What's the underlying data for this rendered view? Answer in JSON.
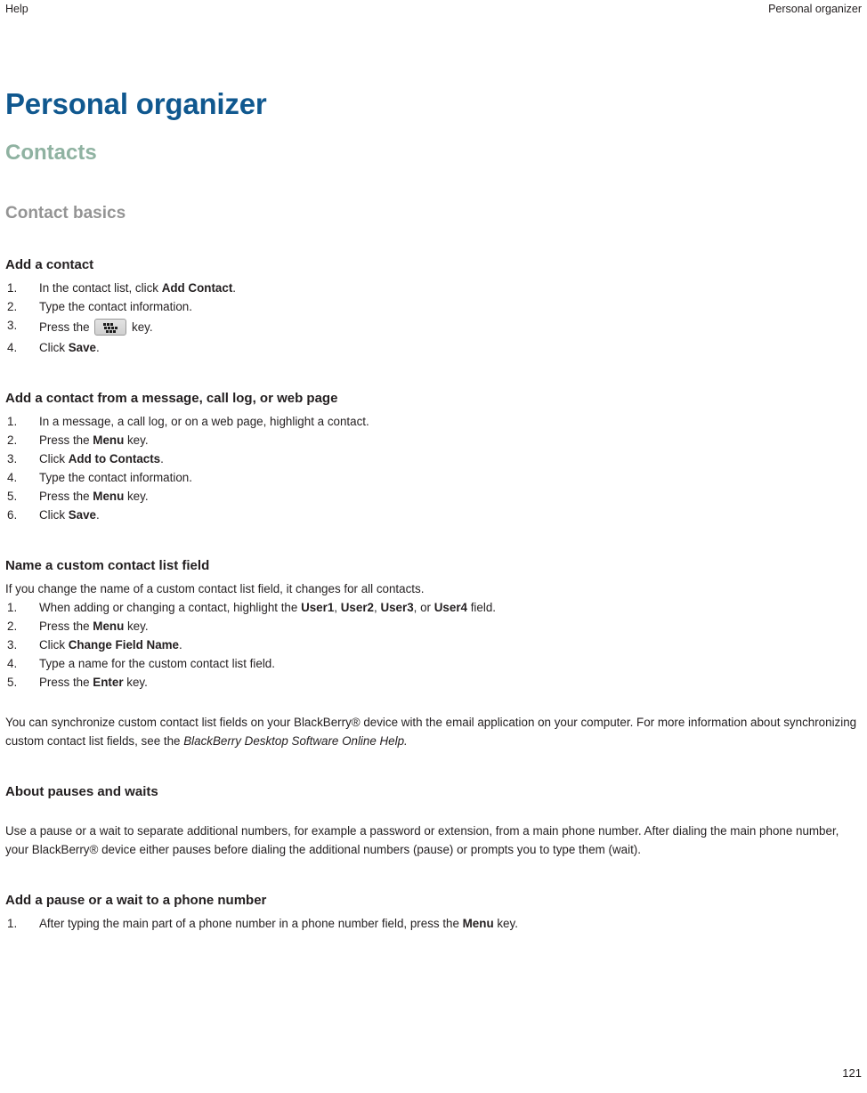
{
  "header": {
    "left": "Help",
    "right": "Personal organizer"
  },
  "footer": {
    "page_number": "121"
  },
  "colors": {
    "title_blue": "#10588f",
    "chapter_green": "#8fb2a1",
    "section_gray": "#949494",
    "body_text": "#231f20"
  },
  "doc": {
    "title": "Personal organizer",
    "chapter": "Contacts",
    "section": "Contact basics"
  },
  "tasks": [
    {
      "heading": "Add a contact",
      "steps": [
        {
          "num": "1.",
          "parts": [
            {
              "t": "text",
              "v": "In the contact list, click "
            },
            {
              "t": "bold",
              "v": "Add Contact"
            },
            {
              "t": "text",
              "v": "."
            }
          ]
        },
        {
          "num": "2.",
          "parts": [
            {
              "t": "text",
              "v": "Type the contact information."
            }
          ]
        },
        {
          "num": "3.",
          "parts": [
            {
              "t": "text",
              "v": "Press the "
            },
            {
              "t": "key",
              "v": "blackberry-menu-key"
            },
            {
              "t": "text",
              "v": " key."
            }
          ]
        },
        {
          "num": "4.",
          "parts": [
            {
              "t": "text",
              "v": "Click "
            },
            {
              "t": "bold",
              "v": "Save"
            },
            {
              "t": "text",
              "v": "."
            }
          ]
        }
      ]
    },
    {
      "heading": "Add a contact from a message, call log, or web page",
      "steps": [
        {
          "num": "1.",
          "parts": [
            {
              "t": "text",
              "v": "In a message, a call log, or on a web page, highlight a contact."
            }
          ]
        },
        {
          "num": "2.",
          "parts": [
            {
              "t": "text",
              "v": "Press the "
            },
            {
              "t": "bold",
              "v": "Menu"
            },
            {
              "t": "text",
              "v": " key."
            }
          ]
        },
        {
          "num": "3.",
          "parts": [
            {
              "t": "text",
              "v": "Click "
            },
            {
              "t": "bold",
              "v": "Add to Contacts"
            },
            {
              "t": "text",
              "v": "."
            }
          ]
        },
        {
          "num": "4.",
          "parts": [
            {
              "t": "text",
              "v": "Type the contact information."
            }
          ]
        },
        {
          "num": "5.",
          "parts": [
            {
              "t": "text",
              "v": "Press the "
            },
            {
              "t": "bold",
              "v": "Menu"
            },
            {
              "t": "text",
              "v": " key."
            }
          ]
        },
        {
          "num": "6.",
          "parts": [
            {
              "t": "text",
              "v": "Click "
            },
            {
              "t": "bold",
              "v": "Save"
            },
            {
              "t": "text",
              "v": "."
            }
          ]
        }
      ]
    },
    {
      "heading": "Name a custom contact list field",
      "intro": [
        {
          "t": "text",
          "v": "If you change the name of a custom contact list field, it changes for all contacts."
        }
      ],
      "steps": [
        {
          "num": "1.",
          "parts": [
            {
              "t": "text",
              "v": "When adding or changing a contact, highlight the "
            },
            {
              "t": "bold",
              "v": "User1"
            },
            {
              "t": "text",
              "v": ", "
            },
            {
              "t": "bold",
              "v": "User2"
            },
            {
              "t": "text",
              "v": ", "
            },
            {
              "t": "bold",
              "v": "User3"
            },
            {
              "t": "text",
              "v": ", or "
            },
            {
              "t": "bold",
              "v": "User4"
            },
            {
              "t": "text",
              "v": " field."
            }
          ]
        },
        {
          "num": "2.",
          "parts": [
            {
              "t": "text",
              "v": "Press the "
            },
            {
              "t": "bold",
              "v": "Menu"
            },
            {
              "t": "text",
              "v": " key."
            }
          ]
        },
        {
          "num": "3.",
          "parts": [
            {
              "t": "text",
              "v": "Click "
            },
            {
              "t": "bold",
              "v": "Change Field Name"
            },
            {
              "t": "text",
              "v": "."
            }
          ]
        },
        {
          "num": "4.",
          "parts": [
            {
              "t": "text",
              "v": "Type a name for the custom contact list field."
            }
          ]
        },
        {
          "num": "5.",
          "parts": [
            {
              "t": "text",
              "v": "Press the "
            },
            {
              "t": "bold",
              "v": "Enter"
            },
            {
              "t": "text",
              "v": " key."
            }
          ]
        }
      ],
      "after": [
        {
          "t": "text",
          "v": "You can synchronize custom contact list fields on your BlackBerry® device with the email application on your computer. For more information about synchronizing custom contact list fields, see the  "
        },
        {
          "t": "italic",
          "v": "BlackBerry Desktop Software Online Help."
        }
      ]
    },
    {
      "heading": "About pauses and waits",
      "after": [
        {
          "t": "text",
          "v": "Use a pause or a wait to separate additional numbers, for example a password or extension, from a main phone number. After dialing the main phone number, your BlackBerry® device either pauses before dialing the additional numbers (pause) or prompts you to type them (wait)."
        }
      ]
    },
    {
      "heading": "Add a pause or a wait to a phone number",
      "steps": [
        {
          "num": "1.",
          "parts": [
            {
              "t": "text",
              "v": "After typing the main part of a phone number in a phone number field, press the "
            },
            {
              "t": "bold",
              "v": "Menu"
            },
            {
              "t": "text",
              "v": " key."
            }
          ]
        }
      ]
    }
  ]
}
